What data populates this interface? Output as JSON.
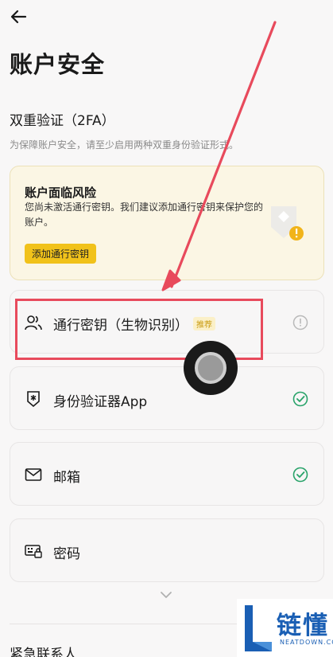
{
  "header": {
    "title": "账户安全"
  },
  "twofa": {
    "title": "双重验证（2FA）",
    "subtitle": "为保障账户安全，请至少启用两种双重身份验证形式。"
  },
  "risk": {
    "title": "账户面临风险",
    "description": "您尚未激活通行密钥。我们建议添加通行密钥来保护您的账户。",
    "button_label": "添加通行密钥"
  },
  "methods": [
    {
      "label": "通行密钥（生物识别）",
      "badge": "推荐",
      "status": "info",
      "icon": "users-icon"
    },
    {
      "label": "身份验证器App",
      "status": "enabled",
      "icon": "authenticator-shield-icon"
    },
    {
      "label": "邮箱",
      "status": "enabled",
      "icon": "mail-icon"
    },
    {
      "label": "密码",
      "status": "none",
      "icon": "password-keyboard-icon"
    }
  ],
  "emergency": {
    "title": "紧急联系人"
  },
  "watermark": {
    "brand": "链懂",
    "domain": "NEATDOWN.COM"
  },
  "colors": {
    "accent": "#f1c21a",
    "success": "#29a36a",
    "annotation": "#e84a5c"
  }
}
